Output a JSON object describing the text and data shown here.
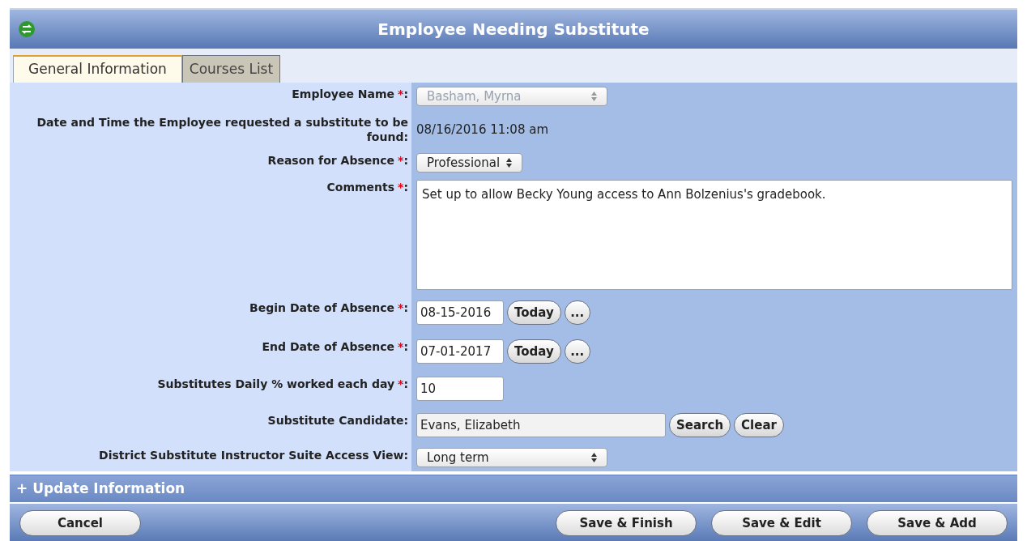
{
  "window": {
    "title": "Employee Needing Substitute"
  },
  "tabs": [
    {
      "label": "General Information",
      "selected": true
    },
    {
      "label": "Courses List",
      "selected": false
    }
  ],
  "fields": [
    {
      "kind": "select",
      "label": "Employee Name",
      "asterisk": "*",
      "colon": ":",
      "value": "Basham, Myrna",
      "disabled": true
    },
    {
      "kind": "text",
      "label": "Date and Time the Employee requested a substitute to be found:",
      "value": "08/16/2016 11:08 am"
    },
    {
      "kind": "select",
      "label": "Reason for Absence",
      "asterisk": "*",
      "colon": ":",
      "value": "Professional",
      "disabled": false
    },
    {
      "kind": "textarea",
      "label": "Comments",
      "asterisk": "*",
      "colon": ":",
      "value": "Set up to allow Becky Young access to Ann Bolzenius's gradebook."
    },
    {
      "kind": "date",
      "label": "Begin Date of Absence",
      "asterisk": "*",
      "colon": ":",
      "value": "08-15-2016",
      "buttons": [
        "Today",
        "..."
      ]
    },
    {
      "kind": "date",
      "label": "End Date of Absence",
      "asterisk": "*",
      "colon": ":",
      "value": "07-01-2017",
      "buttons": [
        "Today",
        "..."
      ]
    },
    {
      "kind": "input",
      "label": "Substitutes Daily % worked each day",
      "asterisk": "*",
      "colon": ":",
      "value": "10"
    },
    {
      "kind": "search",
      "label": "Substitute Candidate:",
      "value": "Evans, Elizabeth",
      "buttons": [
        "Search",
        "Clear"
      ]
    },
    {
      "kind": "select",
      "label": "District Substitute Instructor Suite Access View:",
      "value": "Long term",
      "disabled": false
    }
  ],
  "section": {
    "label": "+ Update Information"
  },
  "footer": {
    "left": [
      "Cancel"
    ],
    "right": [
      "Save & Finish",
      "Save & Edit",
      "Save & Add"
    ]
  }
}
